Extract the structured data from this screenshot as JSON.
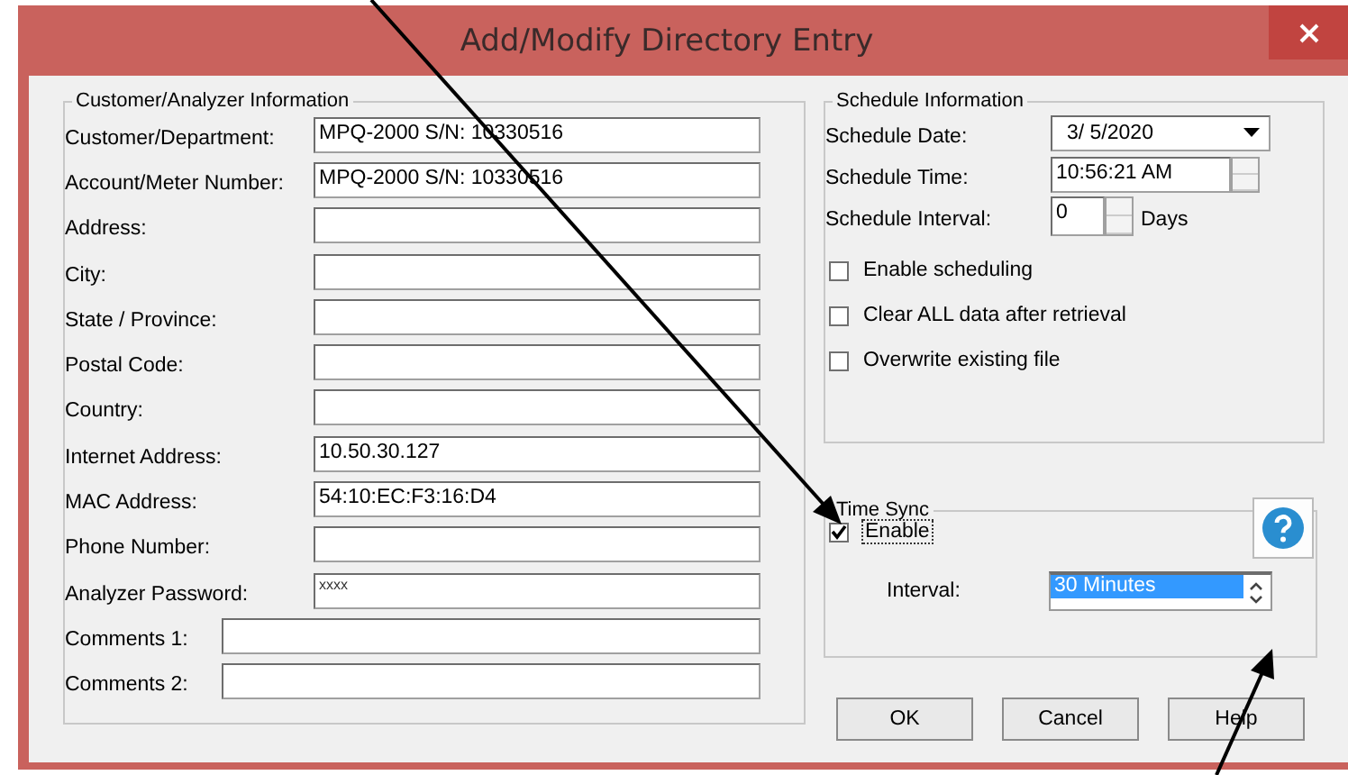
{
  "window": {
    "title": "Add/Modify Directory Entry"
  },
  "customer": {
    "title": "Customer/Analyzer Information",
    "fields": [
      {
        "label": "Customer/Department:",
        "value": "MPQ-2000 S/N: 10330516",
        "kind": "field"
      },
      {
        "label": "Account/Meter Number:",
        "value": "MPQ-2000 S/N: 10330516",
        "kind": "field"
      },
      {
        "label": "Address:",
        "kind": "field"
      },
      {
        "label": "City:",
        "kind": "field"
      },
      {
        "label": "State / Province:",
        "kind": "field"
      },
      {
        "label": "Postal Code:",
        "kind": "field"
      },
      {
        "label": "Country:",
        "kind": "field"
      },
      {
        "label": "Internet Address:",
        "value": "10.50.30.127",
        "kind": "field"
      },
      {
        "label": "MAC Address:",
        "value": "54:10:EC:F3:16:D4",
        "kind": "field"
      },
      {
        "label": "Phone Number:",
        "kind": "field"
      },
      {
        "label": "Analyzer Password:",
        "value": "xxxx",
        "kind": "password"
      },
      {
        "label": "Comments 1:",
        "kind": "comment"
      },
      {
        "label": "Comments 2:",
        "kind": "comment"
      }
    ]
  },
  "schedule": {
    "title": "Schedule Information",
    "date_label": "Schedule Date:",
    "date": "3/  5/2020",
    "time_label": "Schedule Time:",
    "time": "10:56:21 AM",
    "interval_label": "Schedule Interval:",
    "interval": "0",
    "interval_unit": "Days",
    "checkboxes": [
      {
        "label": "Enable scheduling",
        "checked": false
      },
      {
        "label": "Clear ALL data after retrieval",
        "checked": false
      },
      {
        "label": "Overwrite existing file",
        "checked": false
      }
    ]
  },
  "time_sync": {
    "title": "Time Sync",
    "enable": {
      "label": "Enable",
      "checked": true
    },
    "interval_label": "Interval:",
    "interval_options": [
      {
        "label": "30 Minutes",
        "selected": true
      }
    ]
  },
  "buttons": [
    {
      "label": "OK"
    },
    {
      "label": "Cancel"
    },
    {
      "label": "Help"
    }
  ]
}
